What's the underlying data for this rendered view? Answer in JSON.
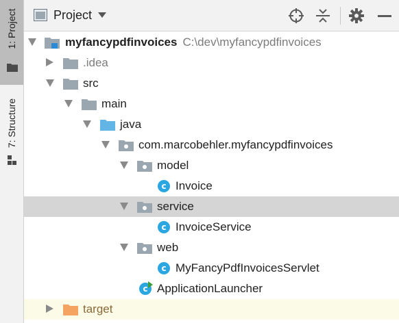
{
  "tool_strip": {
    "project_tab": "1: Project",
    "structure_tab": "7: Structure"
  },
  "header": {
    "title": "Project"
  },
  "tree": {
    "root_name": "myfancypdfinvoices",
    "root_path": "C:\\dev\\myfancypdfinvoices",
    "items": [
      {
        "label": "myfancypdfinvoices"
      },
      {
        "label": ".idea"
      },
      {
        "label": "src"
      },
      {
        "label": "main"
      },
      {
        "label": "java"
      },
      {
        "label": "com.marcobehler.myfancypdfinvoices"
      },
      {
        "label": "model"
      },
      {
        "label": "Invoice"
      },
      {
        "label": "service"
      },
      {
        "label": "InvoiceService"
      },
      {
        "label": "web"
      },
      {
        "label": "MyFancyPdfInvoicesServlet"
      },
      {
        "label": "ApplicationLauncher"
      },
      {
        "label": "target"
      }
    ]
  },
  "colors": {
    "folder_gray": "#9aa7b0",
    "source_folder_blue": "#62b5e5",
    "excluded_folder_orange": "#f4a460",
    "class_icon_blue": "#2aa7e0",
    "selection": "#d5d5d5"
  }
}
